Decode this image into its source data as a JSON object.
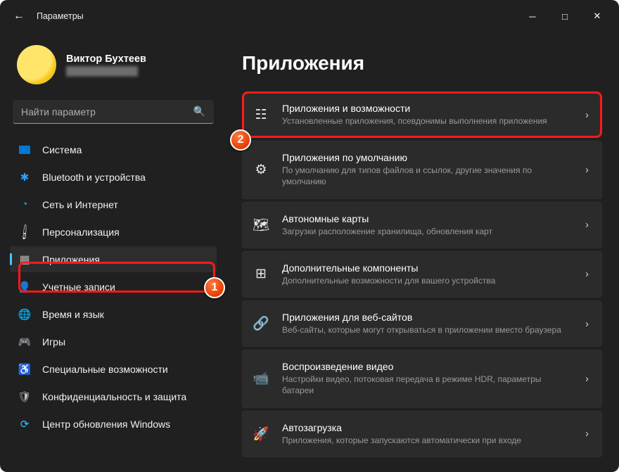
{
  "window": {
    "title": "Параметры"
  },
  "profile": {
    "name": "Виктор Бухтеев",
    "email": "████████████"
  },
  "search": {
    "placeholder": "Найти параметр"
  },
  "sidebar": {
    "items": [
      {
        "label": "Система"
      },
      {
        "label": "Bluetooth и устройства"
      },
      {
        "label": "Сеть и Интернет"
      },
      {
        "label": "Персонализация"
      },
      {
        "label": "Приложения"
      },
      {
        "label": "Учетные записи"
      },
      {
        "label": "Время и язык"
      },
      {
        "label": "Игры"
      },
      {
        "label": "Специальные возможности"
      },
      {
        "label": "Конфиденциальность и защита"
      },
      {
        "label": "Центр обновления Windows"
      }
    ]
  },
  "page": {
    "title": "Приложения"
  },
  "cards": [
    {
      "title": "Приложения и возможности",
      "sub": "Установленные приложения, псевдонимы выполнения приложения"
    },
    {
      "title": "Приложения по умолчанию",
      "sub": "По умолчанию для типов файлов и ссылок, другие значения по умолчанию"
    },
    {
      "title": "Автономные карты",
      "sub": "Загрузки расположение хранилища, обновления карт"
    },
    {
      "title": "Дополнительные компоненты",
      "sub": "Дополнительные возможности для вашего устройства"
    },
    {
      "title": "Приложения для веб-сайтов",
      "sub": "Веб-сайты, которые могут открываться в приложении вместо браузера"
    },
    {
      "title": "Воспроизведение видео",
      "sub": "Настройки видео, потоковая передача в режиме HDR, параметры батареи"
    },
    {
      "title": "Автозагрузка",
      "sub": "Приложения, которые запускаются автоматически при входе"
    }
  ],
  "annotations": {
    "badge1": "1",
    "badge2": "2"
  }
}
